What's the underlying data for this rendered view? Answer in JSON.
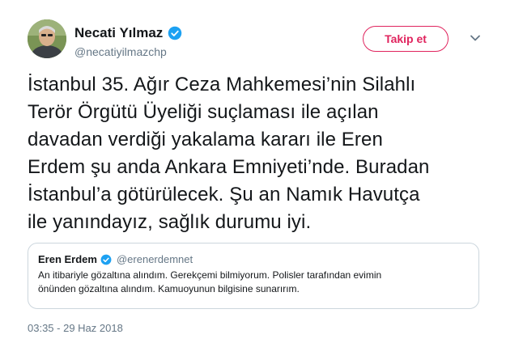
{
  "author": {
    "name": "Necati Yılmaz",
    "handle": "@necatiyilmazchp",
    "verified": true
  },
  "follow_button": {
    "label": "Takip et",
    "color": "#e0245e"
  },
  "tweet": {
    "lines": [
      "İstanbul 35. Ağır Ceza Mahkemesi’nin Silahlı",
      "Terör Örgütü Üyeliği suçlaması ile açılan",
      "davadan verdiği yakalama kararı ile Eren",
      "Erdem şu anda Ankara Emniyeti’nde. Buradan",
      "İstanbul’a götürülecek. Şu an Namık Havutça",
      "ile yanındayız, sağlık durumu iyi."
    ]
  },
  "quoted": {
    "name": "Eren Erdem",
    "handle": "@erenerdemnet",
    "verified": true,
    "lines": [
      "An itibariyle gözaltına alındım. Gerekçemi bilmiyorum. Polisler tarafından evimin",
      "önünden gözaltına alındım. Kamuoyunun bilgisine sunarırım."
    ]
  },
  "timestamp": "03:35 - 29 Haz 2018",
  "colors": {
    "verified_blue": "#1da1f2",
    "secondary_text": "#657786",
    "border": "#ccd6dd"
  },
  "icons": {
    "verified": "verified-badge-icon",
    "caret": "chevron-down-icon"
  }
}
